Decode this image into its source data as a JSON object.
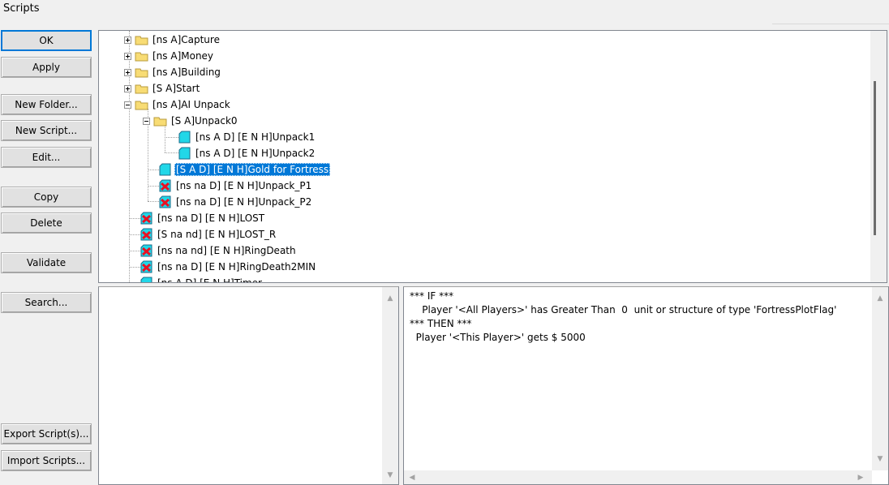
{
  "window": {
    "title": "Scripts"
  },
  "buttons": {
    "ok": "OK",
    "apply": "Apply",
    "new_folder": "New Folder...",
    "new_script": "New Script...",
    "edit": "Edit...",
    "copy": "Copy",
    "delete": "Delete",
    "validate": "Validate",
    "search": "Search...",
    "export": "Export Script(s)...",
    "import": "Import Scripts..."
  },
  "tree": {
    "items": [
      {
        "label": "[ns A]Capture",
        "icon": "folder-icon",
        "expander": "plus"
      },
      {
        "label": "[ns A]Money",
        "icon": "folder-icon",
        "expander": "plus"
      },
      {
        "label": "[ns A]Building",
        "icon": "folder-icon",
        "expander": "plus"
      },
      {
        "label": "[S A]Start",
        "icon": "folder-icon",
        "expander": "plus"
      },
      {
        "label": "[ns A]AI Unpack",
        "icon": "folder-icon",
        "expander": "minus"
      },
      {
        "label": "[S A]Unpack0",
        "icon": "folder-icon",
        "expander": "minus"
      },
      {
        "label": "[ns A D]  [E N H]Unpack1",
        "icon": "script-icon"
      },
      {
        "label": "[ns A D]  [E N H]Unpack2",
        "icon": "script-icon"
      },
      {
        "label": "[S A D]  [E N H]Gold for Fortress",
        "icon": "script-icon",
        "selected": true
      },
      {
        "label": "[ns na D]  [E N H]Unpack_P1",
        "icon": "invalid-script-icon"
      },
      {
        "label": "[ns na D]  [E N H]Unpack_P2",
        "icon": "invalid-script-icon"
      },
      {
        "label": "[ns na D]  [E N H]LOST",
        "icon": "invalid-script-icon"
      },
      {
        "label": "[S na nd]  [E N H]LOST_R",
        "icon": "invalid-script-icon"
      },
      {
        "label": "[ns na nd]  [E N H]RingDeath",
        "icon": "invalid-script-icon"
      },
      {
        "label": "[ns na D]  [E N H]RingDeath2MIN",
        "icon": "invalid-script-icon"
      },
      {
        "label": "[ns A D]  [E N H]Timer",
        "icon": "script-icon"
      }
    ]
  },
  "script_text": {
    "lines": [
      "*** IF ***",
      "    Player '<All Players>' has Greater Than  0  unit or structure of type 'FortressPlotFlag'",
      "*** THEN ***",
      "  Player '<This Player>' gets $ 5000"
    ]
  },
  "colors": {
    "selection": "#0078d7",
    "folder": "#f8dc74",
    "script": "#21d7e8",
    "invalid": "#e81123"
  }
}
